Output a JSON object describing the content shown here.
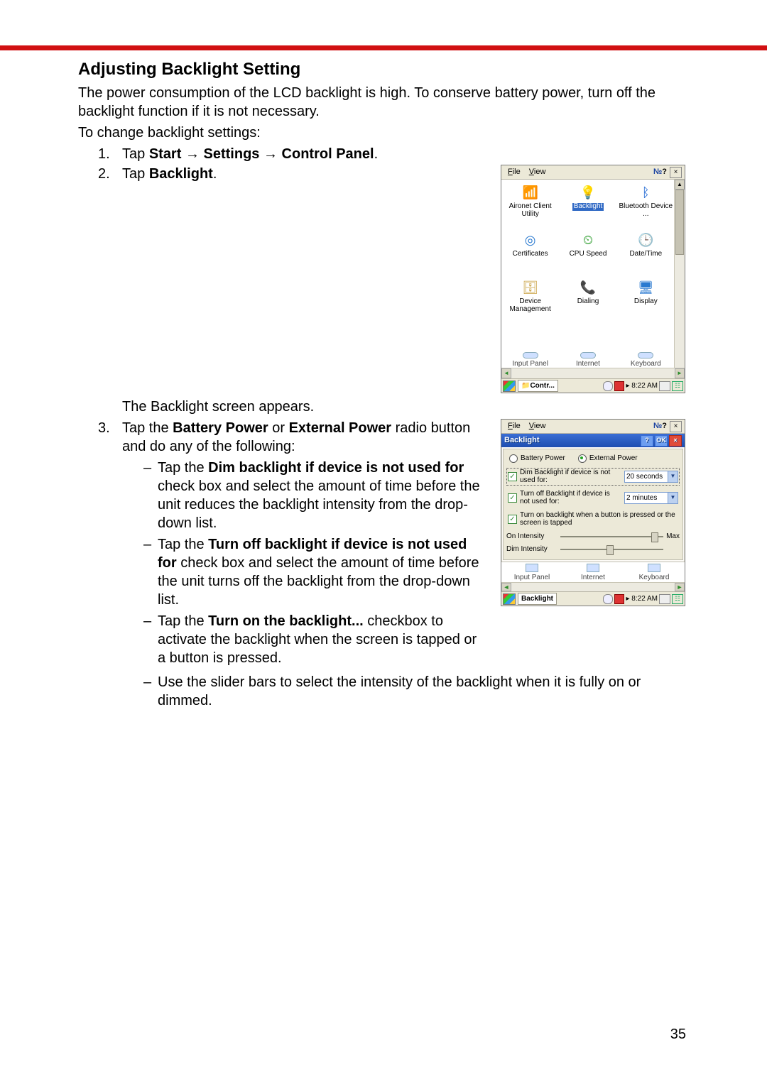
{
  "heading": "Adjusting Backlight Setting",
  "para1": "The power consumption of the LCD backlight is high. To conserve battery power, turn off the backlight function if it is not necessary.",
  "para2": "To change backlight settings:",
  "step1_pre": "Tap ",
  "step1_b1": "Start",
  "step1_arr": " → ",
  "step1_b2": "Settings",
  "step1_b3": "Control Panel",
  "step1_post": ".",
  "step2_pre": "Tap ",
  "step2_b": "Backlight",
  "step2_post": ".",
  "mid_para": "The Backlight screen appears.",
  "step3_pre": "Tap the ",
  "step3_b1": "Battery Power",
  "step3_mid": " or ",
  "step3_b2": "External Power",
  "step3_post": " radio button and do any of the following:",
  "d1_pre": "Tap the ",
  "d1_bold": "Dim backlight if device is not used for",
  "d1_post": " check box and select the amount of time before the unit reduces the backlight intensity from the drop-down list.",
  "d2_pre": "Tap the ",
  "d2_bold": "Turn off backlight if device is not used for",
  "d2_post": " check box and select the amount of time before the unit turns off the backlight from the drop-down list.",
  "d3_pre": "Tap the ",
  "d3_bold": "Turn on the backlight...",
  "d3_post": " checkbox to activate the backlight when the screen is tapped or a button is pressed.",
  "d4": "Use the slider bars to select the intensity of the backlight when it is fully on or dimmed.",
  "cp": {
    "menu_file": "File",
    "menu_view": "View",
    "help": "?",
    "items": [
      {
        "label": "Aironet Client Utility"
      },
      {
        "label": "Backlight",
        "selected": true
      },
      {
        "label": "Bluetooth Device ..."
      },
      {
        "label": "Certificates"
      },
      {
        "label": "CPU Speed"
      },
      {
        "label": "Date/Time"
      },
      {
        "label": "Device Management"
      },
      {
        "label": "Dialing"
      },
      {
        "label": "Display"
      }
    ],
    "row4": [
      "Input Panel",
      "Internet",
      "Keyboard"
    ],
    "task_btn": "Contr...",
    "clock": "8:22 AM"
  },
  "bl": {
    "menu_file": "File",
    "menu_view": "View",
    "title": "Backlight",
    "ok": "OK",
    "radio_battery": "Battery Power",
    "radio_external": "External Power",
    "chk_dim": "Dim Backlight if device is not used for:",
    "dd_dim": "20 seconds",
    "chk_off": "Turn off Backlight if device is not used for:",
    "dd_off": "2 minutes",
    "chk_on": "Turn on backlight when a button is pressed or the screen is tapped",
    "sl_on": "On Intensity",
    "sl_dim": "Dim Intensity",
    "sl_max": "Max",
    "strip": [
      "Input Panel",
      "Internet",
      "Keyboard"
    ],
    "task_btn": "Backlight",
    "clock": "8:22 AM"
  },
  "page_number": "35"
}
